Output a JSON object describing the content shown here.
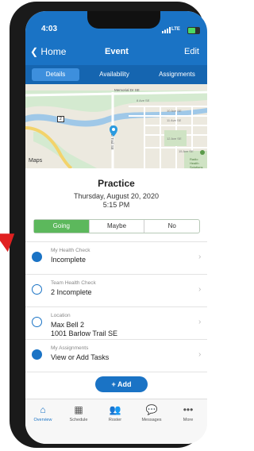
{
  "status": {
    "time": "4:03",
    "carrier": "LTE"
  },
  "navbar": {
    "back_label": "Home",
    "title": "Event",
    "edit_label": "Edit"
  },
  "tabs": [
    {
      "label": "Details",
      "active": true
    },
    {
      "label": "Availability",
      "active": false
    },
    {
      "label": "Assignments",
      "active": false
    }
  ],
  "map": {
    "attribution": "Maps",
    "streets": [
      "Memorial Dr SE",
      "Barlow Trail SE",
      "8 Ave SE",
      "10 Ave SE",
      "11 Ave SE",
      "12 Ave SE",
      "15 Ave SE"
    ],
    "marker_label": "2",
    "poi_label": "Radio Health Solutions"
  },
  "event": {
    "name": "Practice",
    "date": "Thursday, August 20, 2020",
    "time": "5:15 PM"
  },
  "rsvp": {
    "options": [
      "Going",
      "Maybe",
      "No"
    ],
    "selected": "Going"
  },
  "rows": [
    {
      "label": "My Health Check",
      "value": "Incomplete",
      "icon": "heart-icon"
    },
    {
      "label": "Team Health Check",
      "value": "2 Incomplete",
      "icon": "check-circle-icon"
    },
    {
      "label": "Location",
      "value_line1": "Max Bell 2",
      "value_line2": "1001 Barlow Trail SE",
      "icon": "location-pin-icon"
    },
    {
      "label": "My Assignments",
      "value": "View or Add Tasks",
      "icon": "assignment-icon"
    }
  ],
  "add_button": "+ Add",
  "bottom_nav": [
    {
      "label": "Overview",
      "icon": "home-icon",
      "active": true
    },
    {
      "label": "Schedule",
      "icon": "calendar-icon",
      "active": false
    },
    {
      "label": "Roster",
      "icon": "people-icon",
      "active": false
    },
    {
      "label": "Messages",
      "icon": "chat-icon",
      "active": false
    },
    {
      "label": "More",
      "icon": "more-icon",
      "active": false
    }
  ],
  "colors": {
    "primary": "#1a73c5",
    "going": "#5cb85c",
    "arrow": "#e02020"
  }
}
